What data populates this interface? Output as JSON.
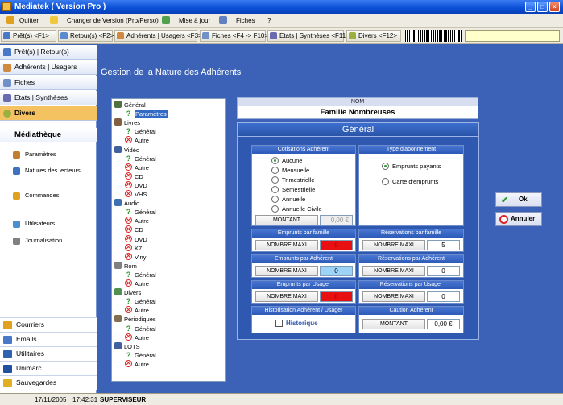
{
  "window": {
    "title": "Mediatek ( Version Pro )",
    "min": "_",
    "max": "□",
    "close": "×"
  },
  "menu": [
    {
      "label": "Quitter",
      "icon": "exit-icon"
    },
    {
      "label": "Changer de Version (Pro/Perso)",
      "icon": "switch-icon"
    },
    {
      "label": "Mise à jour",
      "icon": "update-icon"
    },
    {
      "label": "Fiches",
      "icon": "cards-icon"
    },
    {
      "label": "?",
      "icon": ""
    }
  ],
  "toolbar": [
    {
      "label": "Prêt(s) <F1>",
      "icon": "loan-icon"
    },
    {
      "label": "Retour(s) <F2>",
      "icon": "return-icon"
    },
    {
      "label": "Adhérents | Usagers <F3>",
      "icon": "members-icon"
    },
    {
      "label": "Fiches <F4 -> F10>",
      "icon": "cards-icon"
    },
    {
      "label": "Etats | Synthèses <F11>",
      "icon": "reports-icon"
    },
    {
      "label": "Divers <F12>",
      "icon": "misc-icon"
    }
  ],
  "sidebar": {
    "nav": [
      {
        "label": "Prêt(s) | Retour(s)",
        "active": false
      },
      {
        "label": "Adhérents | Usagers",
        "active": false
      },
      {
        "label": "Fiches",
        "active": false
      },
      {
        "label": "Etats | Synthèses",
        "active": false
      },
      {
        "label": "Divers",
        "active": true
      }
    ],
    "section": "Médiathèque",
    "items": [
      "Paramètres",
      "Natures des lecteurs",
      "Commandes",
      "Utilisateurs",
      "Journalisation"
    ],
    "bottom": [
      "Courriers",
      "Emails",
      "Utilitaires",
      "Unimarc",
      "Sauvegardes"
    ]
  },
  "page": {
    "title": "Gestion de la Nature des Adhérents"
  },
  "tree": [
    {
      "label": "Général",
      "kind": "folder"
    },
    {
      "label": "Paramètres",
      "kind": "q",
      "selected": true
    },
    {
      "label": "Livres",
      "kind": "folder"
    },
    {
      "label": "Général",
      "kind": "q"
    },
    {
      "label": "Autre",
      "kind": "x"
    },
    {
      "label": "Vidéo",
      "kind": "folder"
    },
    {
      "label": "Général",
      "kind": "q"
    },
    {
      "label": "Autre",
      "kind": "x"
    },
    {
      "label": "CD",
      "kind": "x"
    },
    {
      "label": "DVD",
      "kind": "x"
    },
    {
      "label": "VHS",
      "kind": "x"
    },
    {
      "label": "Audio",
      "kind": "folder"
    },
    {
      "label": "Général",
      "kind": "q"
    },
    {
      "label": "Autre",
      "kind": "x"
    },
    {
      "label": "CD",
      "kind": "x"
    },
    {
      "label": "DVD",
      "kind": "x"
    },
    {
      "label": "K7",
      "kind": "x"
    },
    {
      "label": "Vinyl",
      "kind": "x"
    },
    {
      "label": "Rom",
      "kind": "folder"
    },
    {
      "label": "Général",
      "kind": "q"
    },
    {
      "label": "Autre",
      "kind": "x"
    },
    {
      "label": "Divers",
      "kind": "folder"
    },
    {
      "label": "Général",
      "kind": "q"
    },
    {
      "label": "Autre",
      "kind": "x"
    },
    {
      "label": "Périodiques",
      "kind": "folder"
    },
    {
      "label": "Général",
      "kind": "q"
    },
    {
      "label": "Autre",
      "kind": "x"
    },
    {
      "label": "LOTS",
      "kind": "folder"
    },
    {
      "label": "Général",
      "kind": "q"
    },
    {
      "label": "Autre",
      "kind": "x"
    }
  ],
  "form": {
    "nom_header": "NOM",
    "nom_value": "Famille Nombreuses",
    "panel_title": "Général",
    "cotisations": {
      "title": "Cotisations Adhérent",
      "options": [
        "Aucune",
        "Mensuelle",
        "Trimestrielle",
        "Semestrielle",
        "Annuelle",
        "Annuelle Civile"
      ],
      "selected": "Aucune",
      "montant_label": "MONTANT",
      "montant_value": "0,00 €"
    },
    "abonnement": {
      "title": "Type d'abonnement",
      "options": [
        "Emprunts payants",
        "Carte d'emprunts"
      ],
      "selected": "Emprunts payants"
    },
    "emprunts_famille": {
      "title": "Emprunts par famille",
      "label": "NOMBRE MAXI",
      "value": "0"
    },
    "reservations_famille": {
      "title": "Réservations par famille",
      "label": "NOMBRE MAXI",
      "value": "5"
    },
    "emprunts_adherent": {
      "title": "Emprunts par Adhérent",
      "label": "NOMBRE MAXI",
      "value": "0"
    },
    "reservations_adherent": {
      "title": "Réservations par Adhérent",
      "label": "NOMBRE MAXI",
      "value": "0"
    },
    "emprunts_usager": {
      "title": "Emprunts par Usager",
      "label": "NOMBRE MAXI",
      "value": "0"
    },
    "reservations_usager": {
      "title": "Réservations par Usager",
      "label": "NOMBRE MAXI",
      "value": "0"
    },
    "historisation": {
      "title": "Historisation Adhérent / Usager",
      "checkbox": "Historique"
    },
    "caution": {
      "title": "Caution Adhérent",
      "label": "MONTANT",
      "value": "0,00 €"
    }
  },
  "actions": {
    "ok": "Ok",
    "cancel": "Annuler"
  },
  "status": {
    "date": "17/11/2005",
    "time": "17:42:31",
    "user": "SUPERVISEUR"
  }
}
